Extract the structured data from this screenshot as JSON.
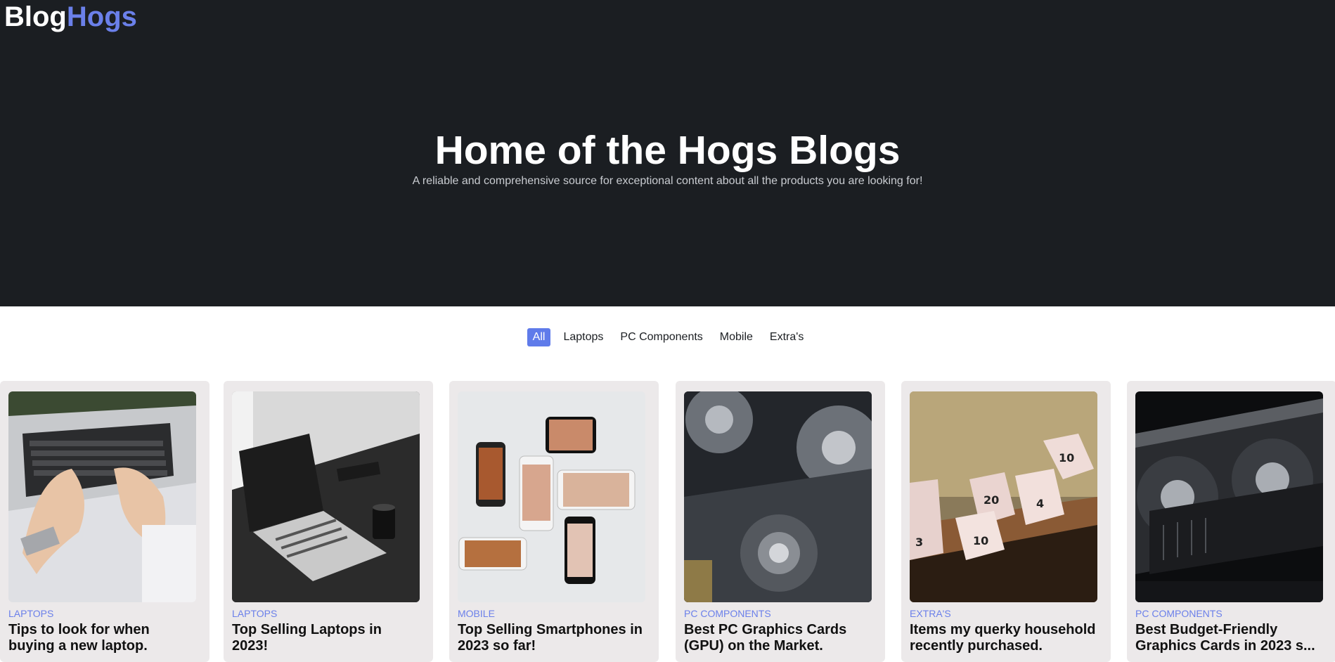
{
  "brand": {
    "part1": "Blog",
    "part2": "Hogs"
  },
  "hero": {
    "title": "Home of the Hogs Blogs",
    "subtitle": "A reliable and comprehensive source for exceptional content about all the products you are looking for!"
  },
  "filters": [
    {
      "label": "All",
      "active": true
    },
    {
      "label": "Laptops",
      "active": false
    },
    {
      "label": "PC Components",
      "active": false
    },
    {
      "label": "Mobile",
      "active": false
    },
    {
      "label": "Extra's",
      "active": false
    }
  ],
  "posts": [
    {
      "category": "Laptops",
      "title": "Tips to look for when\nbuying a new laptop.",
      "image": "hands-typing-laptop-photo"
    },
    {
      "category": "Laptops",
      "title": "Top Selling Laptops in\n2023!",
      "image": "monochrome-laptop-desk-photo"
    },
    {
      "category": "Mobile",
      "title": "Top Selling Smartphones in\n2023 so far!",
      "image": "smartphones-collage-photo"
    },
    {
      "category": "PC Components",
      "title": "Best PC Graphics Cards\n(GPU) on the Market.",
      "image": "graphics-card-closeup-photo"
    },
    {
      "category": "Extra's",
      "title": "Items my querky household\nrecently purchased.",
      "image": "dice-on-table-photo"
    },
    {
      "category": "PC Components",
      "title": "Best Budget-Friendly\nGraphics Cards in 2023 s...",
      "image": "graphics-card-dark-photo"
    }
  ],
  "colors": {
    "hero_bg": "#1b1e22",
    "accent": "#6b80ea",
    "active_filter_bg": "#5f7bea",
    "card_bg": "#ece9ea"
  }
}
